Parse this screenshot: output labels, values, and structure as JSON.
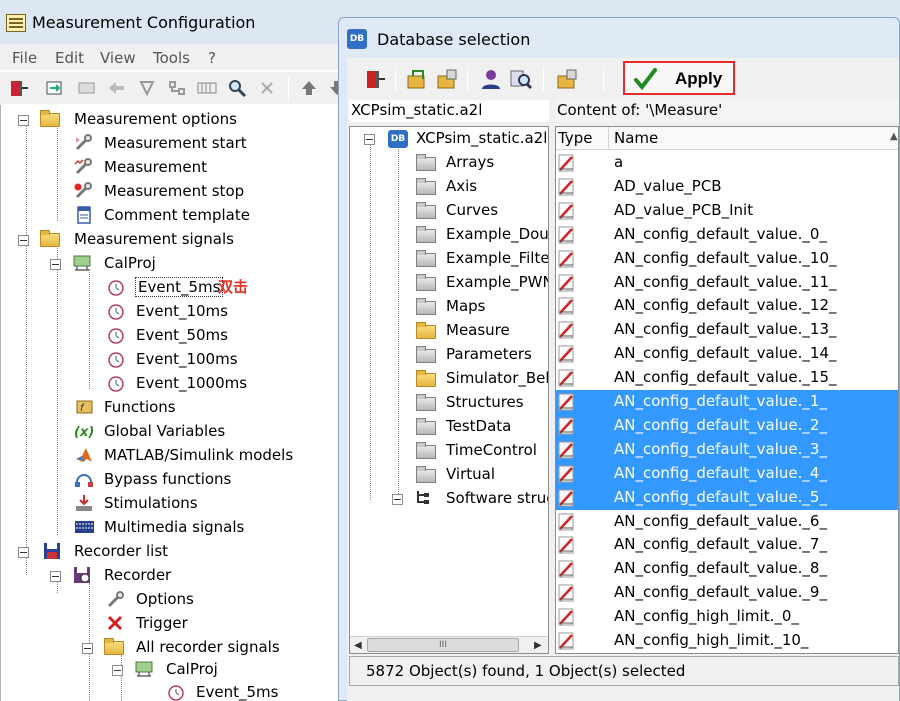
{
  "main_window": {
    "title": "Measurement Configuration",
    "menu": [
      "File",
      "Edit",
      "View",
      "Tools",
      "?"
    ]
  },
  "tree": [
    {
      "label": "Measurement options",
      "icon": "folder-icon"
    },
    {
      "label": "Measurement start",
      "icon": "wrench-start-icon"
    },
    {
      "label": "Measurement",
      "icon": "wrench-chart-icon"
    },
    {
      "label": "Measurement stop",
      "icon": "wrench-stop-icon"
    },
    {
      "label": "Comment template",
      "icon": "document-icon"
    },
    {
      "label": "Measurement signals",
      "icon": "folder-icon"
    },
    {
      "label": "CalProj",
      "icon": "device-icon"
    },
    {
      "label": "Event_5ms",
      "icon": "clock-icon"
    },
    {
      "label": "Event_10ms",
      "icon": "clock-icon"
    },
    {
      "label": "Event_50ms",
      "icon": "clock-icon"
    },
    {
      "label": "Event_100ms",
      "icon": "clock-icon"
    },
    {
      "label": "Event_1000ms",
      "icon": "clock-icon"
    },
    {
      "label": "Functions",
      "icon": "functions-icon"
    },
    {
      "label": "Global Variables",
      "icon": "variable-icon"
    },
    {
      "label": "MATLAB/Simulink models",
      "icon": "matlab-icon"
    },
    {
      "label": "Bypass functions",
      "icon": "bypass-icon"
    },
    {
      "label": "Stimulations",
      "icon": "stimulation-icon"
    },
    {
      "label": "Multimedia signals",
      "icon": "film-icon"
    },
    {
      "label": "Recorder list",
      "icon": "disk-icon"
    },
    {
      "label": "Recorder",
      "icon": "recorder-icon"
    },
    {
      "label": "Options",
      "icon": "wrench-icon"
    },
    {
      "label": "Trigger",
      "icon": "trigger-icon"
    },
    {
      "label": "All recorder signals",
      "icon": "folder-icon"
    },
    {
      "label": "CalProj",
      "icon": "device-icon"
    },
    {
      "label": "Event_5ms",
      "icon": "clock-icon"
    }
  ],
  "annotation": "双击",
  "dialog": {
    "title": "Database selection",
    "icon_text": "DB",
    "apply_label": "Apply",
    "db_header": "XCPsim_static.a2l",
    "content_header": "Content of: '\\Measure'",
    "db_tree": [
      {
        "label": "XCPsim_static.a2l"
      },
      {
        "label": "Arrays"
      },
      {
        "label": "Axis"
      },
      {
        "label": "Curves"
      },
      {
        "label": "Example_Dou"
      },
      {
        "label": "Example_Filte"
      },
      {
        "label": "Example_PWN"
      },
      {
        "label": "Maps"
      },
      {
        "label": "Measure"
      },
      {
        "label": "Parameters"
      },
      {
        "label": "Simulator_Beh"
      },
      {
        "label": "Structures"
      },
      {
        "label": "TestData"
      },
      {
        "label": "TimeControl"
      },
      {
        "label": "Virtual"
      },
      {
        "label": "Software struc"
      }
    ],
    "scroll_thumb": "III",
    "columns": [
      "Type",
      "Name"
    ],
    "rows": [
      {
        "name": "a",
        "selected": false
      },
      {
        "name": "AD_value_PCB",
        "selected": false
      },
      {
        "name": "AD_value_PCB_Init",
        "selected": false
      },
      {
        "name": "AN_config_default_value._0_",
        "selected": false
      },
      {
        "name": "AN_config_default_value._10_",
        "selected": false
      },
      {
        "name": "AN_config_default_value._11_",
        "selected": false
      },
      {
        "name": "AN_config_default_value._12_",
        "selected": false
      },
      {
        "name": "AN_config_default_value._13_",
        "selected": false
      },
      {
        "name": "AN_config_default_value._14_",
        "selected": false
      },
      {
        "name": "AN_config_default_value._15_",
        "selected": false
      },
      {
        "name": "AN_config_default_value._1_",
        "selected": true
      },
      {
        "name": "AN_config_default_value._2_",
        "selected": true
      },
      {
        "name": "AN_config_default_value._3_",
        "selected": true
      },
      {
        "name": "AN_config_default_value._4_",
        "selected": true
      },
      {
        "name": "AN_config_default_value._5_",
        "selected": true
      },
      {
        "name": "AN_config_default_value._6_",
        "selected": false
      },
      {
        "name": "AN_config_default_value._7_",
        "selected": false
      },
      {
        "name": "AN_config_default_value._8_",
        "selected": false
      },
      {
        "name": "AN_config_default_value._9_",
        "selected": false
      },
      {
        "name": "AN_config_high_limit._0_",
        "selected": false
      },
      {
        "name": "AN_config_high_limit._10_",
        "selected": false
      }
    ],
    "status": "5872 Object(s) found,   1 Object(s) selected"
  },
  "colors": {
    "selection": "#3399ff",
    "apply_border": "#e52b2b",
    "annotation": "#e53027",
    "title_bar": "#dde7f3"
  }
}
